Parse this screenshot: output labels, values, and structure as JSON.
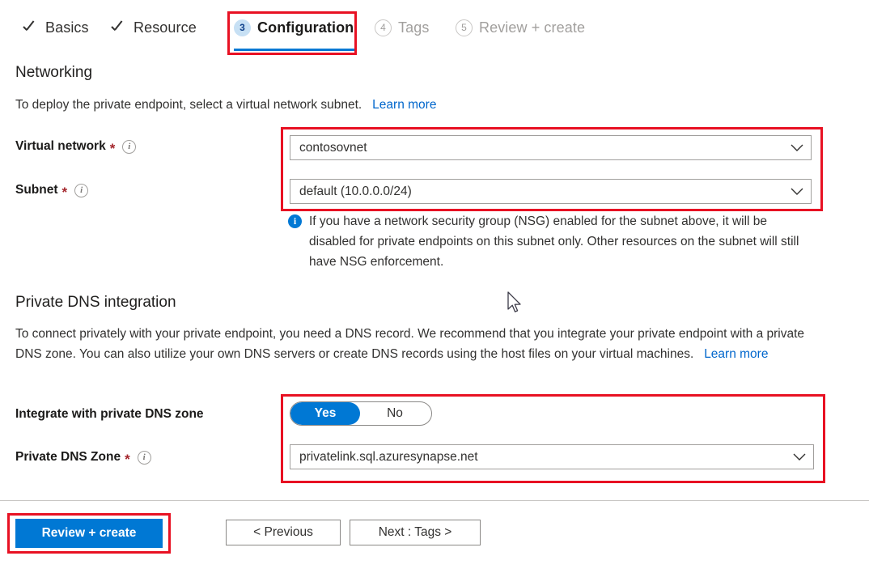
{
  "wizard": {
    "tabs": [
      {
        "label": "Basics",
        "state": "done",
        "marker": "check"
      },
      {
        "label": "Resource",
        "state": "done",
        "marker": "check"
      },
      {
        "label": "Configuration",
        "state": "current",
        "marker": "3"
      },
      {
        "label": "Tags",
        "state": "todo",
        "marker": "4"
      },
      {
        "label": "Review + create",
        "state": "todo",
        "marker": "5"
      }
    ]
  },
  "networking": {
    "heading": "Networking",
    "description": "To deploy the private endpoint, select a virtual network subnet.",
    "learn_more": "Learn more",
    "virtual_network": {
      "label": "Virtual network",
      "required_mark": "*",
      "info_glyph": "i",
      "value": "contosovnet"
    },
    "subnet": {
      "label": "Subnet",
      "required_mark": "*",
      "info_glyph": "i",
      "value": "default (10.0.0.0/24)"
    },
    "nsg_callout": {
      "icon_glyph": "i",
      "text": "If you have a network security group (NSG) enabled for the subnet above, it will be disabled for private endpoints on this subnet only. Other resources on the subnet will still have NSG enforcement."
    }
  },
  "private_dns": {
    "heading": "Private DNS integration",
    "description": "To connect privately with your private endpoint, you need a DNS record. We recommend that you integrate your private endpoint with a private DNS zone. You can also utilize your own DNS servers or create DNS records using the host files on your virtual machines.",
    "learn_more": "Learn more",
    "integrate_toggle": {
      "label": "Integrate with private DNS zone",
      "options": [
        "Yes",
        "No"
      ],
      "selected": "Yes"
    },
    "zone": {
      "label": "Private DNS Zone",
      "required_mark": "*",
      "info_glyph": "i",
      "value": "privatelink.sql.azuresynapse.net"
    }
  },
  "footer": {
    "review_create": "Review + create",
    "previous": "< Previous",
    "next": "Next : Tags >"
  },
  "colors": {
    "accent": "#0078d4",
    "highlight_outline": "#e81123",
    "required": "#a4262c",
    "link": "#0066cc"
  }
}
